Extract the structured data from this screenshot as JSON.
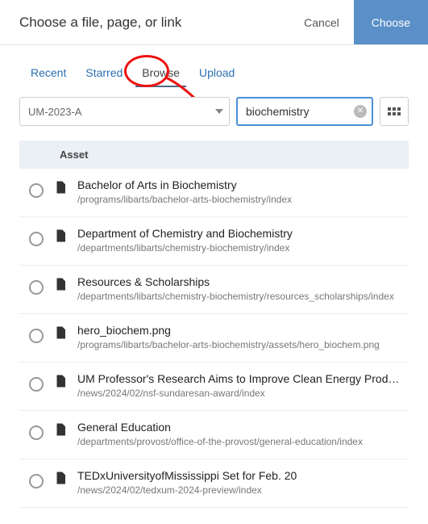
{
  "header": {
    "title": "Choose a file, page, or link",
    "cancel": "Cancel",
    "choose": "Choose"
  },
  "tabs": {
    "recent": "Recent",
    "starred": "Starred",
    "browse": "Browse",
    "upload": "Upload"
  },
  "controls": {
    "site_select": "UM-2023-A",
    "search_value": "biochemistry"
  },
  "list": {
    "header": "Asset",
    "rows": [
      {
        "icon": "page",
        "title": "Bachelor of Arts in Biochemistry",
        "path": "/programs/libarts/bachelor-arts-biochemistry/index"
      },
      {
        "icon": "page",
        "title": "Department of Chemistry and Biochemistry",
        "path": "/departments/libarts/chemistry-biochemistry/index"
      },
      {
        "icon": "page",
        "title": "Resources & Scholarships",
        "path": "/departments/libarts/chemistry-biochemistry/resources_scholarships/index"
      },
      {
        "icon": "image",
        "title": "hero_biochem.png",
        "path": "/programs/libarts/bachelor-arts-biochemistry/assets/hero_biochem.png"
      },
      {
        "icon": "page",
        "title": "UM Professor's Research Aims to Improve Clean Energy Prod…",
        "path": "/news/2024/02/nsf-sundaresan-award/index"
      },
      {
        "icon": "page",
        "title": "General Education",
        "path": "/departments/provost/office-of-the-provost/general-education/index"
      },
      {
        "icon": "page",
        "title": "TEDxUniversityofMississippi Set for Feb. 20",
        "path": "/news/2024/02/tedxum-2024-preview/index"
      }
    ]
  }
}
